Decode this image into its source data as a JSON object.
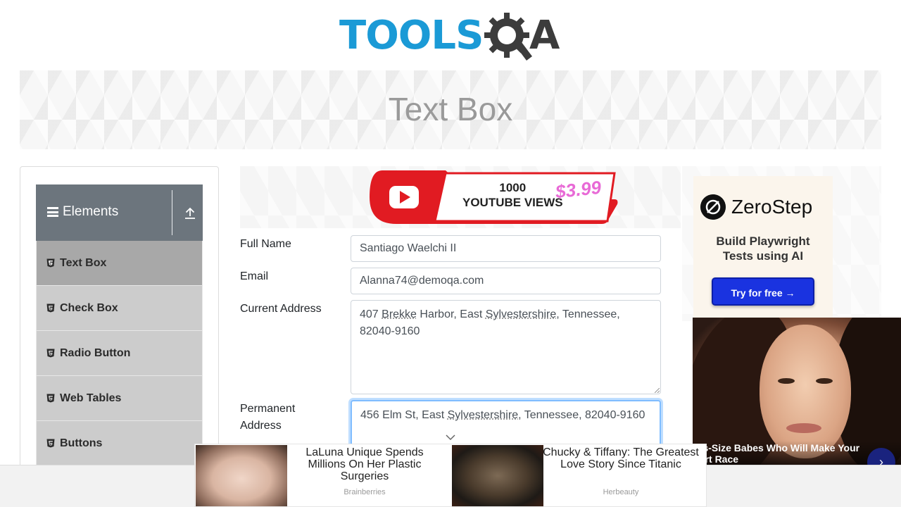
{
  "logo": {
    "part1": "TOOLS",
    "part2": "A",
    "alt": "TOOLSQA"
  },
  "banner": {
    "title": "Text Box"
  },
  "sidebar": {
    "group_label": "Elements",
    "items": [
      {
        "label": "Text Box",
        "active": true
      },
      {
        "label": "Check Box",
        "active": false
      },
      {
        "label": "Radio Button",
        "active": false
      },
      {
        "label": "Web Tables",
        "active": false
      },
      {
        "label": "Buttons",
        "active": false
      }
    ]
  },
  "center_ad": {
    "line1": "1000",
    "line2": "YOUTUBE VIEWS",
    "price": "$3.99"
  },
  "form": {
    "full_name": {
      "label": "Full Name",
      "value": "Santiago Waelchi II"
    },
    "email": {
      "label": "Email",
      "value": "Alanna74@demoqa.com"
    },
    "current_address": {
      "label": "Current Address",
      "parts": [
        "407 ",
        "Brekke",
        " Harbor, East ",
        "Sylvestershire",
        ", Tennessee, 82040-9160"
      ]
    },
    "permanent_address": {
      "label_line1": "Permanent",
      "label_line2": "Address",
      "parts": [
        "456 Elm St, East ",
        "Sylvestershire",
        ", Tennessee, 82040-9160"
      ]
    }
  },
  "right_ad": {
    "brand": "ZeroStep",
    "tagline_line1": "Build Playwright",
    "tagline_line2": "Tests using AI",
    "cta": "Try for free →"
  },
  "video_ad": {
    "caption_line1": "lus-Size Babes Who Will Make Your",
    "caption_line2": "eart Race"
  },
  "bottom_ads": [
    {
      "title": "LaLuna Unique Spends Millions On Her Plastic Surgeries",
      "source": "Brainberries"
    },
    {
      "title": "Chucky & Tiffany: The Greatest Love Story Since Titanic",
      "source": "Herbeauty"
    }
  ],
  "colors": {
    "brand_blue": "#1b9ad6",
    "nav_header": "#6c757d",
    "active_item": "#a8a8a8",
    "focus_border": "#80bdff",
    "cta_blue": "#1a33e0"
  }
}
